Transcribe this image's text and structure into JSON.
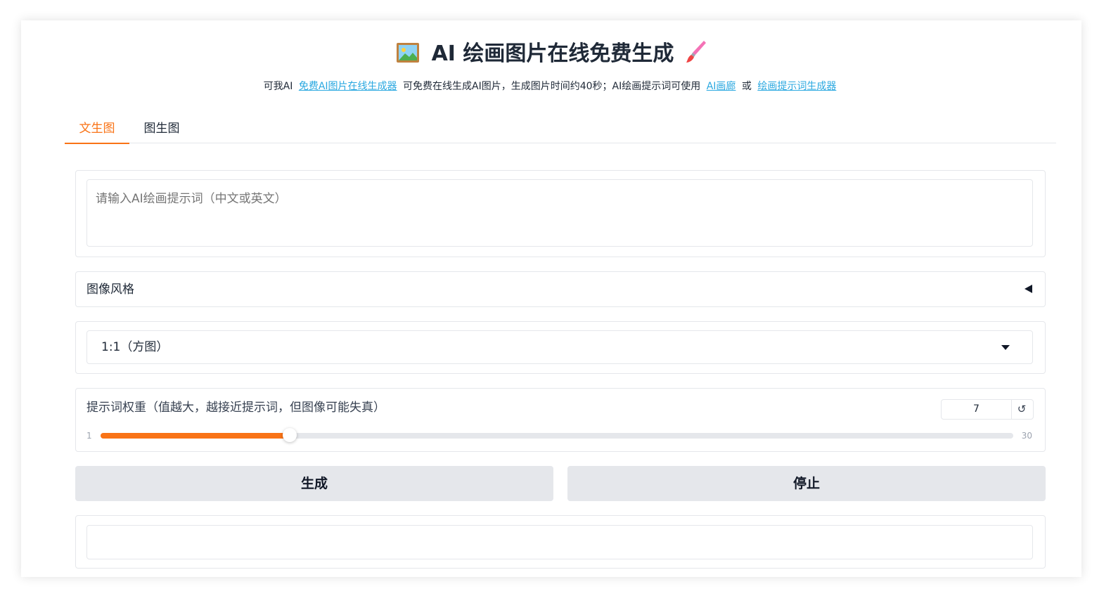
{
  "header": {
    "title_icon_left": "framed-picture-icon",
    "title": "AI 绘画图片在线免费生成",
    "title_icon_right": "paintbrush-icon",
    "subtitle": {
      "part1": "可我AI",
      "link1": "免费AI图片在线生成器",
      "part2": "可免费在线生成AI图片，生成图片时间约40秒；AI绘画提示词可使用",
      "link2": "AI画廊",
      "part3": "或",
      "link3": "绘画提示词生成器"
    }
  },
  "tabs": [
    {
      "label": "文生图",
      "active": true
    },
    {
      "label": "图生图",
      "active": false
    }
  ],
  "prompt": {
    "placeholder": "请输入AI绘画提示词（中文或英文）",
    "value": ""
  },
  "style_accordion": {
    "label": "图像风格",
    "collapsed": true
  },
  "aspect_select": {
    "value": "1:1（方图）"
  },
  "weight_slider": {
    "label": "提示词权重（值越大，越接近提示词，但图像可能失真）",
    "value": "7",
    "min": "1",
    "max": "30",
    "reset_icon": "reset-icon"
  },
  "buttons": {
    "generate": "生成",
    "stop": "停止"
  },
  "colors": {
    "accent": "#f97316",
    "link": "#2aa8e0",
    "button_bg": "#e5e7eb"
  }
}
